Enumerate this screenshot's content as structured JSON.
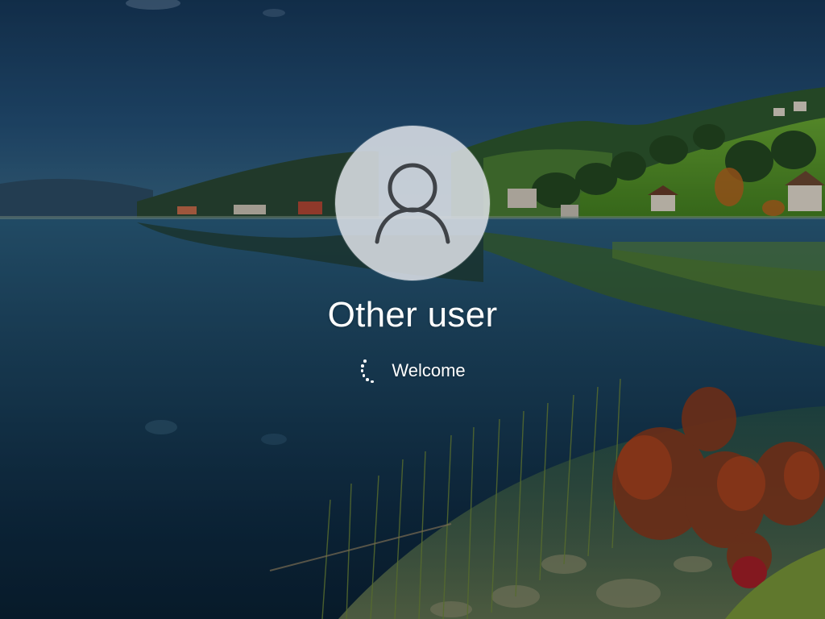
{
  "login": {
    "username": "Other user",
    "status_text": "Welcome"
  },
  "icons": {
    "avatar": "user-silhouette-icon",
    "spinner": "loading-spinner-icon"
  },
  "colors": {
    "text": "#ffffff",
    "avatar_background": "#dde1e7",
    "avatar_glyph": "#3f4348"
  }
}
